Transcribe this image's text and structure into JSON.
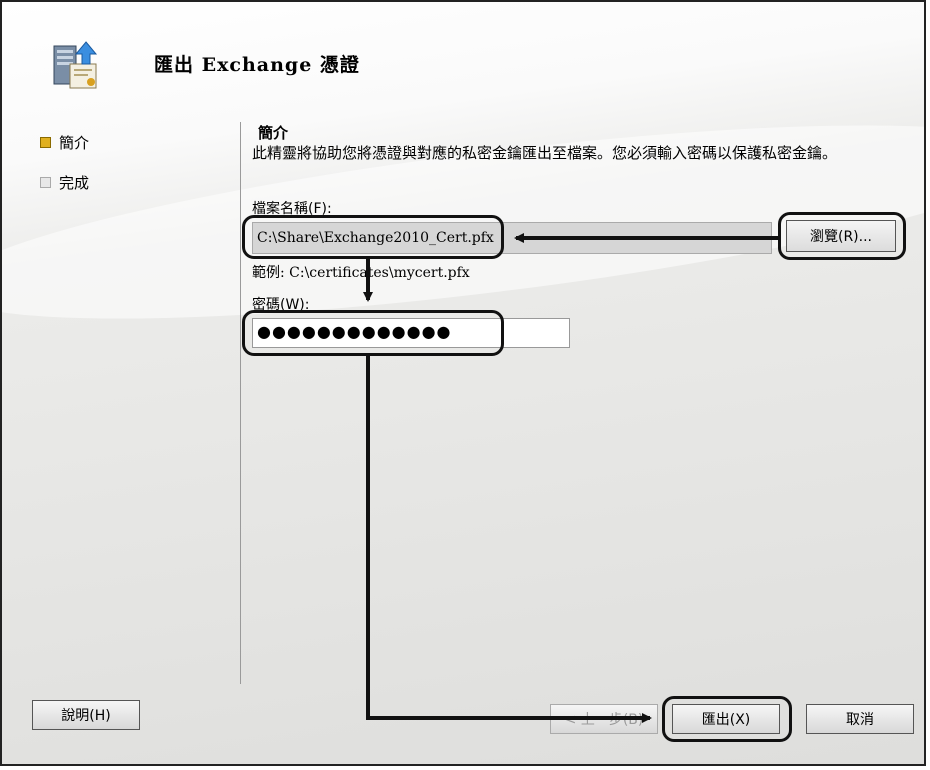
{
  "header": {
    "title": "匯出 Exchange 憑證",
    "icon": "certificate-export-icon"
  },
  "nav": {
    "items": [
      {
        "label": "簡介",
        "state": "active"
      },
      {
        "label": "完成",
        "state": "inactive"
      }
    ]
  },
  "main": {
    "heading": "簡介",
    "description": "此精靈將協助您將憑證與對應的私密金鑰匯出至檔案。您必須輸入密碼以保護私密金鑰。",
    "filename_label": "檔案名稱(F):",
    "filename_value": "C:\\Share\\Exchange2010_Cert.pfx",
    "browse_label": "瀏覽(R)...",
    "example_text": "範例: C:\\certificates\\mycert.pfx",
    "password_label": "密碼(W):",
    "password_value": "●●●●●●●●●●●●●"
  },
  "footer": {
    "help_label": "說明(H)",
    "back_label": "< 上一步(B)",
    "export_label": "匯出(X)",
    "cancel_label": "取消"
  },
  "colors": {
    "active_marker": "#e0b020",
    "callout": "#111111"
  }
}
